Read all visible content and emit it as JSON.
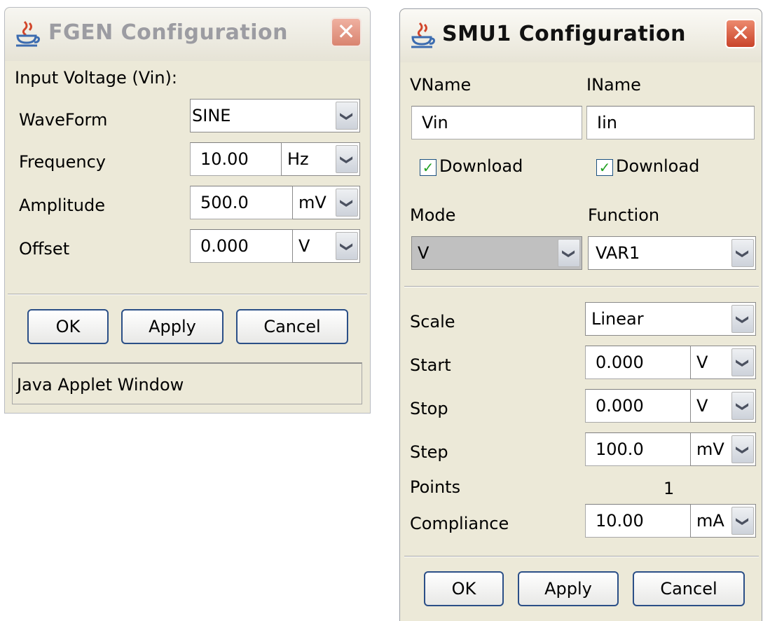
{
  "fgen": {
    "title": "FGEN Configuration",
    "close": "✕",
    "section_label": "Input Voltage (Vin):",
    "waveform_label": "WaveForm",
    "waveform_value": "SINE",
    "frequency_label": "Frequency",
    "frequency_value": "10.00",
    "frequency_unit": "Hz",
    "amplitude_label": "Amplitude",
    "amplitude_value": "500.0",
    "amplitude_unit": "mV",
    "offset_label": "Offset",
    "offset_value": "0.000",
    "offset_unit": "V",
    "ok_label": "OK",
    "apply_label": "Apply",
    "cancel_label": "Cancel",
    "status_text": "Java Applet Window"
  },
  "smu": {
    "title": "SMU1 Configuration",
    "close": "✕",
    "vname_label": "VName",
    "vname_value": "Vin",
    "iname_label": "IName",
    "iname_value": "Iin",
    "download_label": "Download",
    "mode_label": "Mode",
    "mode_value": "V",
    "function_label": "Function",
    "function_value": "VAR1",
    "scale_label": "Scale",
    "scale_value": "Linear",
    "start_label": "Start",
    "start_value": "0.000",
    "start_unit": "V",
    "stop_label": "Stop",
    "stop_value": "0.000",
    "stop_unit": "V",
    "step_label": "Step",
    "step_value": "100.0",
    "step_unit": "mV",
    "points_label": "Points",
    "points_value": "1",
    "compliance_label": "Compliance",
    "compliance_value": "10.00",
    "compliance_unit": "mA",
    "ok_label": "OK",
    "apply_label": "Apply",
    "cancel_label": "Cancel"
  },
  "icons": {
    "dropdown": "chevron-down-icon",
    "check": "checkmark-icon",
    "app": "java-cup-icon"
  },
  "glyphs": {
    "arrow": "❯",
    "check": "✓"
  },
  "colors": {
    "window_bg": "#ece9d8",
    "button_border": "#2b4f87",
    "check_green": "#21a121",
    "close_red": "#c9432a"
  }
}
